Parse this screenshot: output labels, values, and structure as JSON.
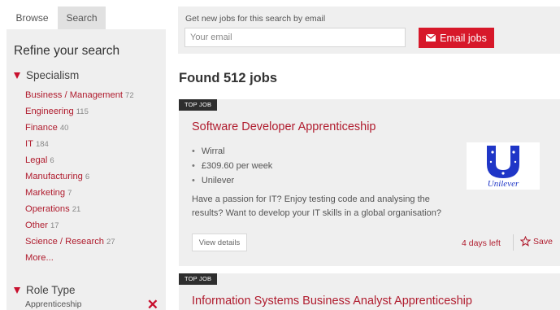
{
  "sidebar": {
    "tabs": [
      {
        "label": "Browse"
      },
      {
        "label": "Search"
      }
    ],
    "refine_title": "Refine your search",
    "specialism": {
      "heading": "Specialism",
      "items": [
        {
          "label": "Business / Management",
          "count": "72"
        },
        {
          "label": "Engineering",
          "count": "115"
        },
        {
          "label": "Finance",
          "count": "40"
        },
        {
          "label": "IT",
          "count": "184"
        },
        {
          "label": "Legal",
          "count": "6"
        },
        {
          "label": "Manufacturing",
          "count": "6"
        },
        {
          "label": "Marketing",
          "count": "7"
        },
        {
          "label": "Operations",
          "count": "21"
        },
        {
          "label": "Other",
          "count": "17"
        },
        {
          "label": "Science / Research",
          "count": "27"
        },
        {
          "label": "More...",
          "count": ""
        }
      ]
    },
    "role_type": {
      "heading": "Role Type",
      "selected": "Apprenticeship"
    }
  },
  "email_alert": {
    "label": "Get new jobs for this search by email",
    "placeholder": "Your email",
    "button": "Email jobs"
  },
  "results": {
    "found_text": "Found 512 jobs"
  },
  "jobs": [
    {
      "tag": "TOP JOB",
      "title": "Software Developer Apprenticeship",
      "details": [
        "Wirral",
        "£309.60 per week",
        "Unilever"
      ],
      "logo_text": "Unilever",
      "description": "Have a passion for IT? Enjoy testing code and analysing the results? Want to develop your IT skills in a global organisation?",
      "view_label": "View details",
      "days_left": "4 days left",
      "save_label": "Save"
    },
    {
      "tag": "TOP JOB",
      "title": "Information Systems Business Analyst Apprenticeship"
    }
  ],
  "colors": {
    "accent": "#d7182a",
    "link": "#b01c2e",
    "panel": "#efefef",
    "logo_blue": "#1f36c7"
  }
}
